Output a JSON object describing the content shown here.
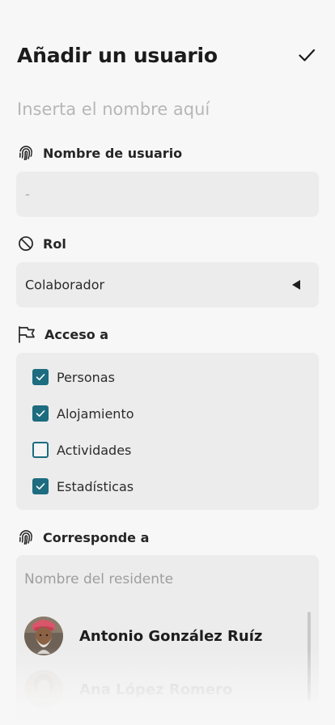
{
  "header": {
    "title": "Añadir un usuario",
    "confirm_icon": "checkmark-icon"
  },
  "name_input": {
    "placeholder": "Inserta el nombre aquí",
    "value": ""
  },
  "username": {
    "label": "Nombre de usuario",
    "icon": "fingerprint-icon",
    "value": "-"
  },
  "role": {
    "label": "Rol",
    "icon": "prohibited-icon",
    "value": "Colaborador",
    "dropdown_icon": "triangle-left-icon"
  },
  "access": {
    "label": "Acceso a",
    "icon": "flag-icon",
    "items": [
      {
        "label": "Personas",
        "checked": true
      },
      {
        "label": "Alojamiento",
        "checked": true
      },
      {
        "label": "Actividades",
        "checked": false
      },
      {
        "label": "Estadísticas",
        "checked": true
      }
    ]
  },
  "corresponds": {
    "label": "Corresponde a",
    "icon": "fingerprint-icon",
    "search_placeholder": "Nombre del residente",
    "residents": [
      {
        "name": "Antonio González Ruíz"
      },
      {
        "name": "Ana López Romero"
      }
    ]
  },
  "colors": {
    "accent": "#1d6c7f",
    "field_bg": "#ececec",
    "page_bg": "#f7f7f7"
  }
}
